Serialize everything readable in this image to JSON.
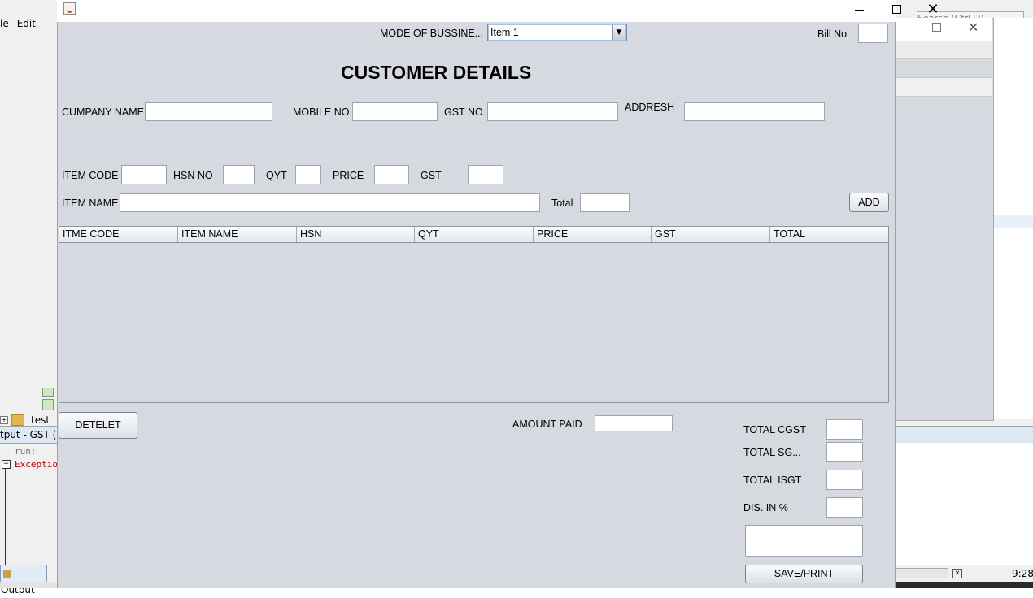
{
  "ide": {
    "menu": [
      "le",
      "Edit"
    ],
    "tree_item": "test",
    "output_title": "tput - GST (ru",
    "run_text": "run:",
    "exception_text": "Exceptio",
    "output_tab": "Output",
    "search_placeholder": "Search (Ctrl+I)",
    "time": "9:28"
  },
  "window": {
    "mode_label": "MODE OF BUSSINE...",
    "mode_selected": "Item 1",
    "bill_label": "Bill No",
    "title": "CUSTOMER DETAILS"
  },
  "customer": {
    "company_label": "CUMPANY NAME",
    "mobile_label": "MOBILE NO",
    "gst_label": "GST NO",
    "address_label": "ADDRESH"
  },
  "item": {
    "code_label": "ITEM CODE",
    "hsn_label": "HSN NO",
    "qty_label": "QYT",
    "price_label": "PRICE",
    "gst_label": "GST",
    "name_label": "ITEM NAME",
    "total_label": "Total",
    "add_button": "ADD"
  },
  "table": {
    "columns": [
      "ITME CODE",
      "ITEM NAME",
      "HSN",
      "QYT",
      "PRICE",
      "GST",
      "TOTAL"
    ],
    "rows": []
  },
  "footer": {
    "delete_button": "DETELET",
    "amount_paid_label": "AMOUNT PAID",
    "total_cgst_label": "TOTAL CGST",
    "total_sgst_label": "TOTAL SG...",
    "total_isgt_label": "TOTAL ISGT",
    "discount_label": "DIS. IN %",
    "save_button": "SAVE/PRINT"
  }
}
